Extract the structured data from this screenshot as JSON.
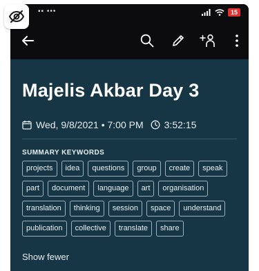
{
  "status_bar": {
    "left_glyphs": "▪▪ •••",
    "battery": "15"
  },
  "note": {
    "title": "Majelis Akbar Day 3",
    "date": "Wed, 9/8/2021 • 7:00 PM",
    "duration": "3:52:15"
  },
  "summary": {
    "label": "SUMMARY KEYWORDS",
    "keywords": [
      "projects",
      "idea",
      "questions",
      "group",
      "create",
      "speak",
      "part",
      "document",
      "language",
      "art",
      "organisation",
      "translation",
      "thinking",
      "session",
      "space",
      "understand",
      "publication",
      "collective",
      "translate",
      "share"
    ],
    "toggle_label": "Show fewer"
  },
  "colors": {
    "background": "#163645",
    "appbar": "#0c0c0e",
    "chip_border": "#9fb3bd",
    "battery": "#e03030"
  }
}
